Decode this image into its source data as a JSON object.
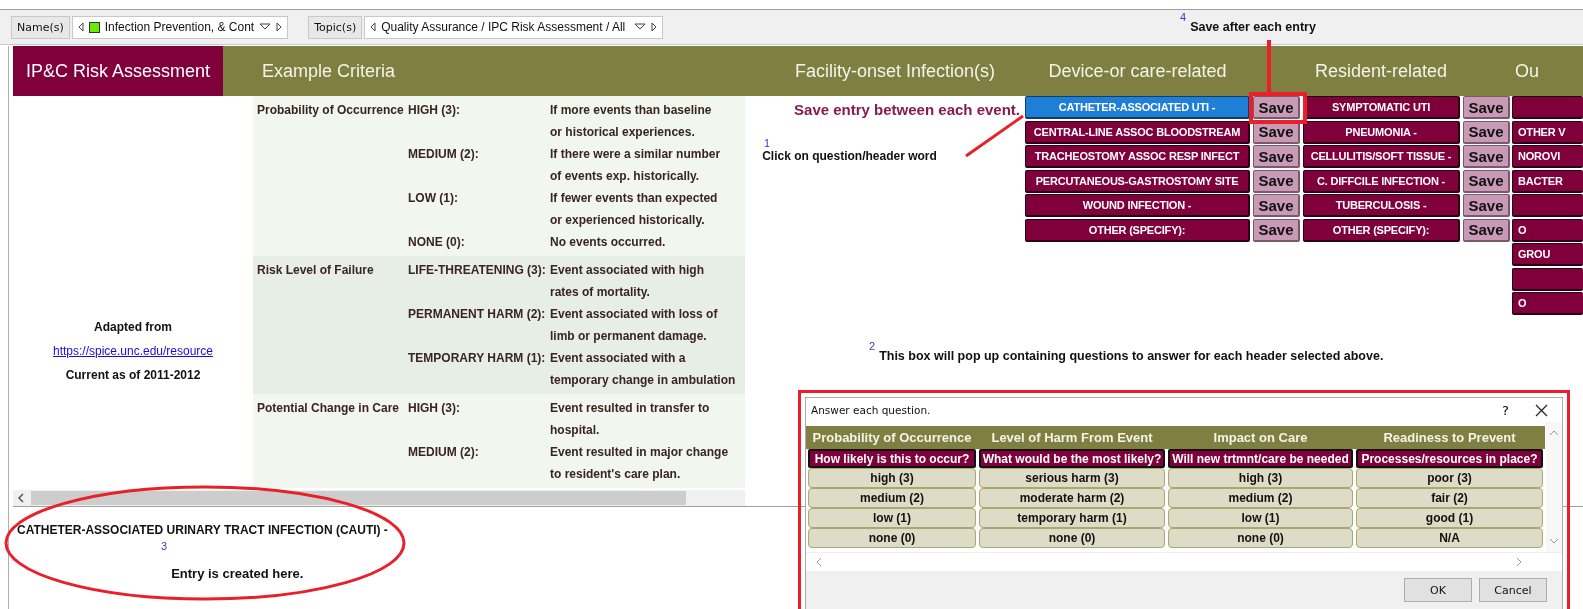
{
  "toolbar": {
    "filters": [
      {
        "label": "Name(s)",
        "value": "Infection Prevention, & Cont",
        "swatch": true
      },
      {
        "label": "Topic(s)",
        "value": "Quality Assurance / IPC Risk Assessment / All",
        "swatch": false
      }
    ]
  },
  "header": {
    "title": "IP&C Risk Assessment",
    "columns": [
      "Example Criteria",
      "Facility-onset Infection(s)",
      "Device-or care-related",
      "Resident-related",
      "Ou"
    ]
  },
  "source": {
    "lead": "Adapted from",
    "link": "https://spice.unc.edu/resource",
    "note": "Current as of 2011-2012"
  },
  "criteria": [
    {
      "category": "Probability of Occurrence",
      "levels": [
        {
          "level": "HIGH (3):",
          "lines": [
            "If more events than baseline",
            "or historical experiences."
          ]
        },
        {
          "level": "MEDIUM (2):",
          "lines": [
            "If there were a similar number",
            "of events exp. historically."
          ]
        },
        {
          "level": "LOW (1):",
          "lines": [
            "If fewer events than expected",
            "or experienced historically."
          ]
        },
        {
          "level": "NONE (0):",
          "lines": [
            "No events occurred."
          ]
        }
      ]
    },
    {
      "category": "Risk Level of Failure",
      "levels": [
        {
          "level": "LIFE-THREATENING (3):",
          "lines": [
            "Event associated with high",
            "rates of mortality."
          ]
        },
        {
          "level": "PERMANENT HARM (2):",
          "lines": [
            "Event associated with loss of",
            "limb or permanent damage."
          ]
        },
        {
          "level": "TEMPORARY HARM (1):",
          "lines": [
            "Event associated with a",
            "temporary change in ambulation"
          ]
        }
      ]
    },
    {
      "category": "Potential Change in Care",
      "levels": [
        {
          "level": "HIGH (3):",
          "lines": [
            "Event resulted in transfer to",
            "hospital."
          ]
        },
        {
          "level": "MEDIUM (2):",
          "lines": [
            "Event resulted in major change",
            "to resident's care plan."
          ]
        }
      ]
    }
  ],
  "instruction": "Save entry between each event.",
  "event_columns": [
    {
      "items": [
        {
          "label": "CATHETER-ASSOCIATED UTI -",
          "selected": true,
          "save": "Save"
        },
        {
          "label": "CENTRAL-LINE ASSOC BLOODSTREAM",
          "selected": false,
          "save": "Save"
        },
        {
          "label": "TRACHEOSTOMY ASSOC RESP INFECT",
          "selected": false,
          "save": "Save"
        },
        {
          "label": "PERCUTANEOUS-GASTROSTOMY SITE",
          "selected": false,
          "save": "Save"
        },
        {
          "label": "WOUND INFECTION -",
          "selected": false,
          "save": "Save"
        },
        {
          "label": "OTHER (SPECIFY):",
          "selected": false,
          "save": "Save"
        }
      ]
    },
    {
      "items": [
        {
          "label": "SYMPTOMATIC UTI",
          "selected": false,
          "save": "Save"
        },
        {
          "label": "PNEUMONIA -",
          "selected": false,
          "save": "Save"
        },
        {
          "label": "CELLULITIS/SOFT TISSUE -",
          "selected": false,
          "save": "Save"
        },
        {
          "label": "C. DIFFCILE INFECTION -",
          "selected": false,
          "save": "Save"
        },
        {
          "label": "TUBERCULOSIS -",
          "selected": false,
          "save": "Save"
        },
        {
          "label": "OTHER (SPECIFY):",
          "selected": false,
          "save": "Save"
        }
      ]
    },
    {
      "items": [
        {
          "selected": false
        },
        {
          "label": "OTHER V",
          "selected": false
        },
        {
          "label": "NOROVI",
          "selected": false
        },
        {
          "label": "BACTER",
          "selected": false
        },
        {
          "selected": false
        },
        {
          "label": "O",
          "selected": false
        },
        {
          "label": "GROU",
          "selected": false
        },
        {
          "selected": false
        },
        {
          "label": "O",
          "selected": false
        }
      ]
    }
  ],
  "entry": "CATHETER-ASSOCIATED URINARY TRACT INFECTION (CAUTI) -",
  "dialog": {
    "title": "Answer each question.",
    "help": "?",
    "columns": [
      {
        "header": "Probability of Occurrence",
        "question": "How likely is this to occur?",
        "answers": [
          "high (3)",
          "medium (2)",
          "low (1)",
          "none (0)"
        ]
      },
      {
        "header": "Level of Harm From Event",
        "question": "What would be the most likely?",
        "answers": [
          "serious harm (3)",
          "moderate harm (2)",
          "temporary harm (1)",
          "none (0)"
        ]
      },
      {
        "header": "Impact on Care",
        "question": "Will new trtmnt/care be needed",
        "answers": [
          "high (3)",
          "medium (2)",
          "low (1)",
          "none (0)"
        ]
      },
      {
        "header": "Readiness to Prevent",
        "question": "Processes/resources in place?",
        "answers": [
          "poor (3)",
          "fair (2)",
          "good (1)",
          "N/A"
        ]
      }
    ],
    "buttons": [
      "OK",
      "Cancel"
    ]
  },
  "annotations": [
    {
      "number": "4",
      "text": "Save after each entry"
    },
    {
      "number": "1",
      "text": "Click on question/header word"
    },
    {
      "number": "2",
      "text": "This box will pop up containing questions to answer for each header selected above."
    },
    {
      "number": "3",
      "text": "Entry is created here."
    }
  ]
}
